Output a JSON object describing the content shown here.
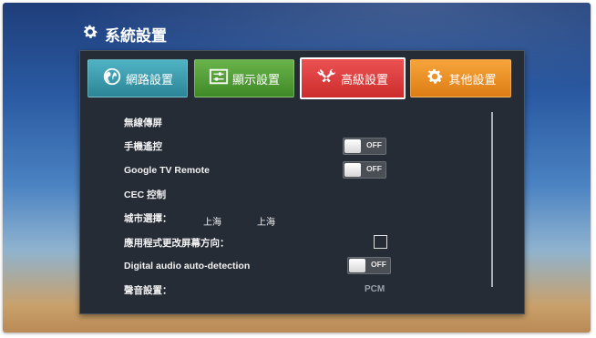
{
  "window": {
    "title": "系統設置",
    "title_icon": "gear-icon"
  },
  "tabs": [
    {
      "label": "網路設置",
      "icon": "globe-icon"
    },
    {
      "label": "顯示設置",
      "icon": "display-sliders-icon"
    },
    {
      "label": "高級設置",
      "icon": "tools-icon",
      "selected": true
    },
    {
      "label": "其他設置",
      "icon": "gear-icon"
    }
  ],
  "settings": {
    "wireless_display": {
      "label": "無線傳屏"
    },
    "phone_remote": {
      "label": "手機遙控",
      "toggle": "OFF"
    },
    "google_tv_remote": {
      "label": "Google TV Remote",
      "toggle": "OFF"
    },
    "cec": {
      "label": "CEC 控制"
    },
    "city": {
      "label": "城市選擇：",
      "value1": "上海",
      "value2": "上海"
    },
    "app_orientation": {
      "label": "應用程式更改屏幕方向：",
      "checked": false
    },
    "digital_audio": {
      "label": "Digital audio auto-detection",
      "toggle": "OFF"
    },
    "sound": {
      "label": "聲音設置：",
      "value": "PCM"
    }
  },
  "colors": {
    "tab_network": "#2b8596",
    "tab_display": "#3e8a27",
    "tab_advanced": "#cc2c2c",
    "tab_other": "#dd7d15",
    "panel": "#262c36"
  }
}
